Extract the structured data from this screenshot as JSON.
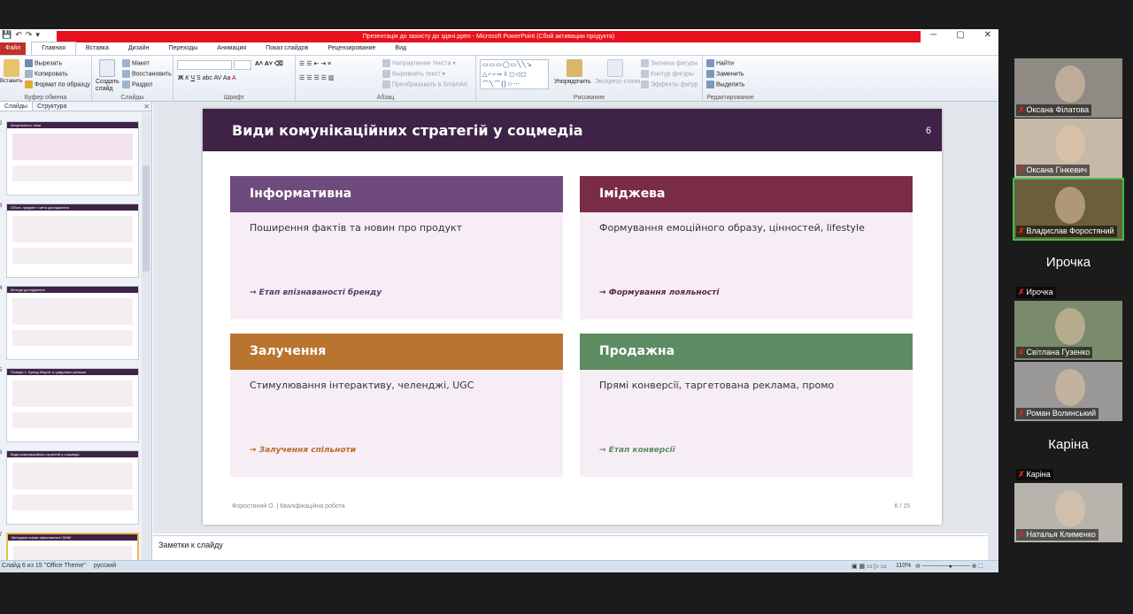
{
  "app": {
    "title": "Презентація до захисту до здачі.pptm - Microsoft PowerPoint (Сбой активации продукта)"
  },
  "qat": [
    "💾",
    "↶",
    "↷",
    "▾"
  ],
  "window_controls": [
    "─",
    "▢",
    "✕"
  ],
  "ribbon_tabs": [
    "Файл",
    "Главная",
    "Вставка",
    "Дизайн",
    "Переходы",
    "Анимация",
    "Показ слайдов",
    "Рецензирование",
    "Вид"
  ],
  "ribbon": {
    "clipboard": {
      "paste": "Вставить",
      "cut": "Вырезать",
      "copy": "Копировать",
      "format": "Формат по образцу",
      "label": "Буфер обмена"
    },
    "slides": {
      "new": "Создать слайд",
      "layout": "Макет",
      "reset": "Восстановить",
      "section": "Раздел",
      "label": "Слайды"
    },
    "font": {
      "label": "Шрифт"
    },
    "paragraph": {
      "text_dir": "Направление текста",
      "align_text": "Выровнять текст",
      "smartart": "Преобразовать в SmartArt",
      "label": "Абзац"
    },
    "drawing": {
      "arrange": "Упорядочить",
      "quick_styles": "Экспресс-стили",
      "fill": "Заливка фигуры",
      "outline": "Контур фигуры",
      "effects": "Эффекты фигур",
      "label": "Рисование",
      "shapes_gallery": "▭▭▭◯▭╲╲↘ △⌐⌐⇨⇩◻◁◻ ⌒╲⌒{}☆⋯"
    },
    "editing": {
      "find": "Найти",
      "replace": "Заменить",
      "select": "Выделить",
      "label": "Редактирование"
    }
  },
  "left_pane": {
    "tabs": [
      "Слайды",
      "Структура"
    ],
    "thumbs": [
      {
        "num": "2",
        "title": "Актуальність теми",
        "color": "#3e2346"
      },
      {
        "num": "3",
        "title": "Об'єкт, предмет і мета дослідження",
        "color": "#3e2346"
      },
      {
        "num": "4",
        "title": "Методи дослідження",
        "color": "#3e2346"
      },
      {
        "num": "5",
        "title": "Позиція 1. Бренд Wayne: в цифрових каналах",
        "color": "#3e2346"
      },
      {
        "num": "6",
        "title": "Види комунікаційних стратегій у соцмедіа",
        "color": "#3e2346"
      },
      {
        "num": "7",
        "title": "Методики оцінки ефективності SMM",
        "color": "#3e2346"
      }
    ]
  },
  "slide": {
    "title": "Види комунікаційних стратегій у соцмедіа",
    "number": "6",
    "cards": [
      {
        "header": "Інформативна",
        "body": "Поширення фактів та новин про продукт",
        "footer": "→ Етап впізнаваності бренду",
        "color": "#6e4a7e",
        "footer_color": "#5b3a6b"
      },
      {
        "header": "Іміджева",
        "body": "Формування емоційного образу, цінностей, lifestyle",
        "footer": "→ Формування лояльності",
        "color": "#7a2c46",
        "footer_color": "#5a2a3e"
      },
      {
        "header": "Залучення",
        "body": "Стимулювання інтерактиву, челенджі, UGC",
        "footer": "→ Залучення спільноти",
        "color": "#b97430",
        "footer_color": "#b86a2a"
      },
      {
        "header": "Продажна",
        "body": "Прямі конверсії, таргетована реклама, промо",
        "footer": "→ Етап конверсії",
        "color": "#5d8b62",
        "footer_color": "#5d8b62"
      }
    ],
    "footer": "Форостяний О.  |  Кваліфікаційна робота",
    "page": "6 / 15"
  },
  "notes": "Заметки к слайду",
  "status": {
    "slide": "Слайд 6 из 15",
    "theme": "\"Office Theme\"",
    "lang": "русский",
    "zoom": "110%"
  },
  "participants": [
    {
      "name": "Оксана Філатова",
      "video": true,
      "bg": "#8f8a84"
    },
    {
      "name": "Оксана Гінкевич",
      "video": true,
      "bg": "#c7b9a8"
    },
    {
      "name": "Владислав Форостяний",
      "video": true,
      "bg": "#6b5e3d",
      "active": true
    },
    {
      "name": "Ирочка",
      "video": false,
      "bg": "#1b1b1b",
      "big": "Ирочка"
    },
    {
      "name": "Світлана Гузенко",
      "video": true,
      "bg": "#7a8a6c"
    },
    {
      "name": "Роман Волинський",
      "video": true,
      "bg": "#9a9896"
    },
    {
      "name": "Каріна",
      "video": false,
      "bg": "#1b1b1b",
      "big": "Каріна"
    },
    {
      "name": "Наталья Клименко",
      "video": true,
      "bg": "#b7b3ad"
    }
  ]
}
